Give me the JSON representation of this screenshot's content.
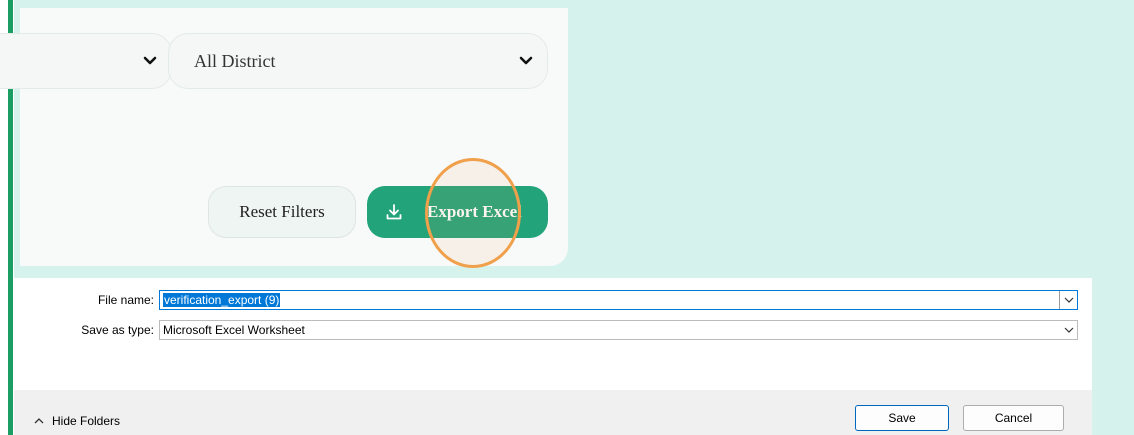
{
  "filters": {
    "select_1_value": "",
    "district_select_value": "All District",
    "reset_label": "Reset Filters",
    "export_label": "Export Excel"
  },
  "save_dialog": {
    "file_name_label": "File name:",
    "file_name_value": "verification_export (9)",
    "save_type_label": "Save as type:",
    "save_type_value": "Microsoft Excel Worksheet",
    "hide_folders_label": "Hide Folders",
    "save_label": "Save",
    "cancel_label": "Cancel"
  },
  "colors": {
    "accent_green": "#23a37a",
    "page_bg": "#d5f3ec",
    "click_marker": "#f0a04a",
    "windows_blue": "#0078d7"
  },
  "icons": [
    "chevron-down-icon",
    "download-icon",
    "chevron-up-icon"
  ]
}
